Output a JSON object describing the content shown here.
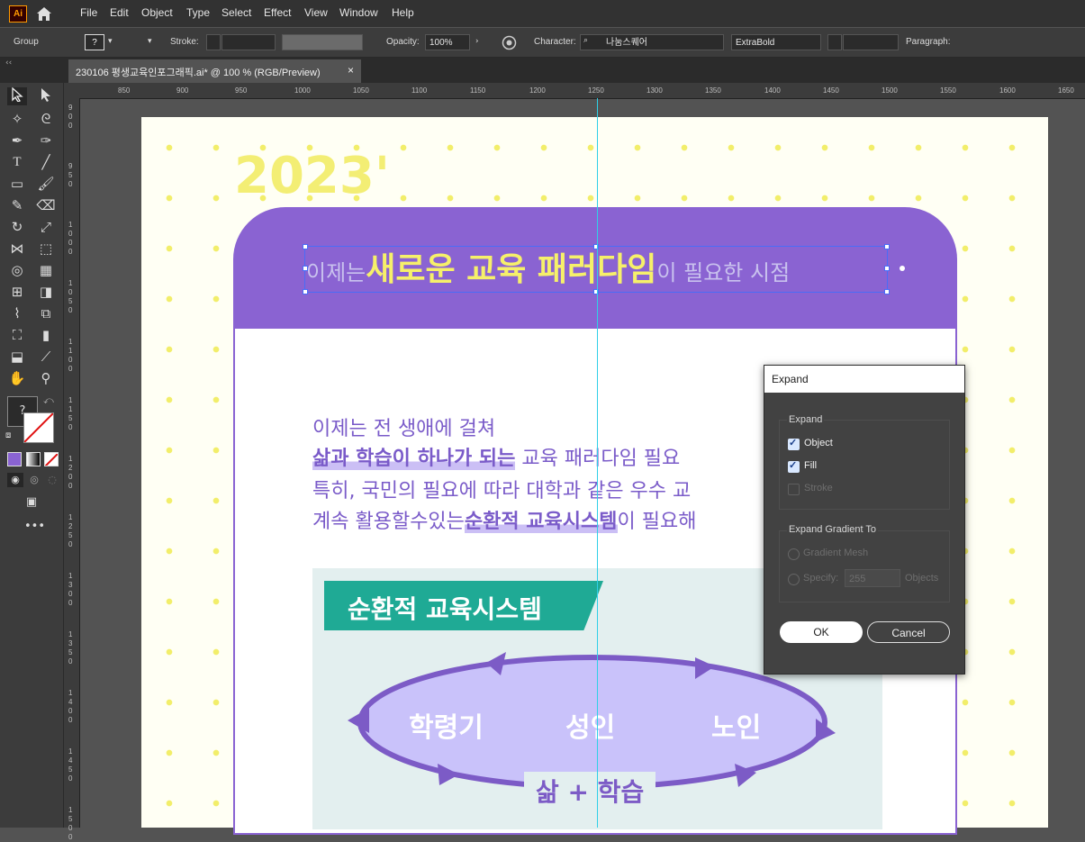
{
  "app": {
    "logo": "Ai"
  },
  "menu": [
    "File",
    "Edit",
    "Object",
    "Type",
    "Select",
    "Effect",
    "View",
    "Window",
    "Help"
  ],
  "control": {
    "selection_type": "Group",
    "stroke_label": "Stroke:",
    "opacity_label": "Opacity:",
    "opacity_value": "100%",
    "character_label": "Character:",
    "font_family": "나눔스퀘어",
    "font_style": "ExtraBold",
    "paragraph_label": "Paragraph:",
    "fill_swatch_text": "?"
  },
  "tab": {
    "title": "230106 평생교육인포그래픽.ai* @ 100 % (RGB/Preview)",
    "close": "×"
  },
  "ruler": {
    "h": [
      "850",
      "900",
      "950",
      "1000",
      "1050",
      "1100",
      "1150",
      "1200",
      "1250",
      "1300",
      "1350",
      "1400",
      "1450",
      "1500",
      "1550",
      "1600",
      "1650"
    ],
    "v": [
      "900",
      "950",
      "1000",
      "1050",
      "1100",
      "1150",
      "1200",
      "1250",
      "1300",
      "1350",
      "1400",
      "1450",
      "1500"
    ]
  },
  "artwork": {
    "year": "2023'",
    "headline_pre": "이제는",
    "headline_bold": "새로운 교육 패러다임",
    "headline_post": "이 필요한 시점",
    "line1": "이제는 전 생애에 걸쳐",
    "line2_hl": "삶과 학습이 하나가 되는",
    "line2_rest": " 교육 패러다임 필요",
    "line3": "특히, 국민의 필요에 따라 대학과 같은 우수 교",
    "line4_pre": "계속 활용할수있는",
    "line4_hl": "순환적 교육시스템",
    "line4_post": "이 필요해",
    "ribbon": "순환적 교육시스템",
    "stage1": "학령기",
    "stage2": "성인",
    "stage3": "노인",
    "cycle_label": "삶 + 학습"
  },
  "dialog": {
    "title": "Expand",
    "expand_group": "Expand",
    "object": "Object",
    "fill": "Fill",
    "stroke": "Stroke",
    "gradient_group": "Expand Gradient To",
    "gradient_mesh": "Gradient Mesh",
    "specify": "Specify:",
    "specify_value": "255",
    "objects": "Objects",
    "ok": "OK",
    "cancel": "Cancel",
    "object_checked": true,
    "fill_checked": true,
    "stroke_checked": false
  },
  "colors": {
    "purple": "#8a63d2",
    "yellow": "#f6f06a",
    "teal": "#1faa95",
    "guide": "#2fd0e8"
  }
}
